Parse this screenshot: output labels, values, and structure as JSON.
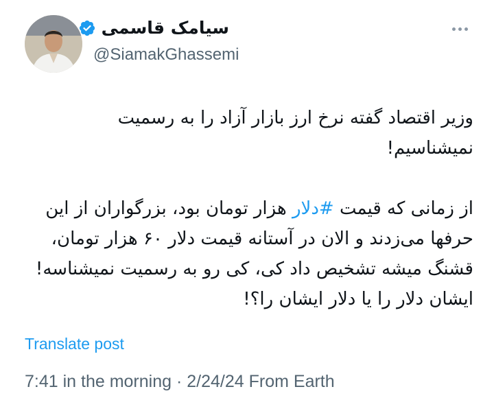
{
  "author": {
    "display_name": "سیامک قاسمی",
    "handle": "@SiamakGhassemi",
    "verified_icon": "verified-badge-icon",
    "avatar_icon": "profile-photo"
  },
  "more_icon": "more-options-icon",
  "tweet": {
    "paragraph1": "وزیر اقتصاد گفته نرخ ارز بازار آزاد را به رسمیت نمیشناسیم!",
    "paragraph2_before": "از زمانی که قیمت ",
    "hashtag": "#دلار",
    "paragraph2_after": " هزار تومان بود، بزرگواران از این حرفها می‌زدند و الان در آستانه قیمت دلار ۶۰ هزار تومان، قشنگ میشه تشخیص داد کی، کی رو به رسمیت نمیشناسه! ایشان دلار را یا دلار ایشان را؟!"
  },
  "translate_label": "Translate post",
  "meta": {
    "time": "7:41 in the morning",
    "separator": " · ",
    "date": "2/24/24",
    "source": " From Earth"
  },
  "colors": {
    "link": "#1d9bf0",
    "secondary_text": "#536471",
    "primary_text": "#0f1419"
  }
}
